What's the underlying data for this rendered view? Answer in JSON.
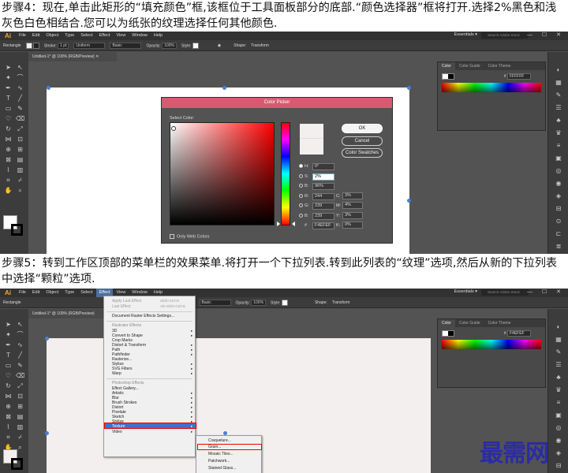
{
  "captions": {
    "step4": "步骤4：现在,单击此矩形的“填充颜色”框,该框位于工具面板部分的底部.“颜色选择器”框将打开.选择2%黑色和浅灰色白色相结合.您可以为纸张的纹理选择任何其他颜色.",
    "step5": "步骤5：转到工作区顶部的菜单栏的效果菜单.将打开一个下拉列表.转到此列表的“纹理”选项,然后从新的下拉列表中选择“颗粒”选项."
  },
  "app": {
    "logo": "Ai",
    "menu": [
      "File",
      "Edit",
      "Object",
      "Type",
      "Select",
      "Effect",
      "View",
      "Window",
      "Help"
    ],
    "workspace": "Essentials ▾",
    "search_placeholder": "Search Adobe Stock",
    "window_controls": "— ☐ ✕"
  },
  "control_bar": {
    "selection": "Rectangle",
    "stroke_label": "Stroke:",
    "stroke_value": "1 pt",
    "profile": "Uniform",
    "brush": "Basic",
    "opacity_label": "Opacity:",
    "opacity_value": "100%",
    "style_label": "Style:",
    "shape_label": "Shape:",
    "transform_label": "Transform"
  },
  "doc_tab": {
    "title": "Untitled-1* @ 100% (RGB/Preview)",
    "close": "✕"
  },
  "color_panel": {
    "tabs": [
      "Color",
      "Color Guide",
      "Color Theme"
    ],
    "hex_label": "#",
    "hex_value": "FFFFFF",
    "hex_value2": "F4EFEF"
  },
  "color_picker": {
    "title": "Color Picker",
    "select_label": "Select Color:",
    "buttons": {
      "ok": "OK",
      "cancel": "Cancel",
      "swatches": "Color Swatches"
    },
    "fields": {
      "h_label": "H:",
      "h_value": "0°",
      "s_label": "S:",
      "s_value": "2%",
      "b_label": "B:",
      "b_value": "96%",
      "r_label": "R:",
      "r_value": "244",
      "g_label": "G:",
      "g_value": "239",
      "bl_label": "B:",
      "bl_value": "239",
      "hex_label": "#",
      "hex_value": "F4EFEF",
      "c_label": "C:",
      "c_value": "3%",
      "m_label": "M:",
      "m_value": "4%",
      "y_label": "Y:",
      "y_value": "3%",
      "k_label": "K:",
      "k_value": "0%"
    },
    "web_only": "Only Web Colors",
    "colors": {
      "current": "#F4EFEF"
    }
  },
  "effect_menu": {
    "top_items": [
      {
        "label": "Apply Last Effect",
        "shortcut": "Shift+Ctrl+E"
      },
      {
        "label": "Last Effect",
        "shortcut": "Alt+Shift+Ctrl+E"
      }
    ],
    "raster_settings": "Document Raster Effects Settings...",
    "illustrator_header": "Illustrator Effects",
    "illustrator_items": [
      "3D",
      "Convert to Shape",
      "Crop Marks",
      "Distort & Transform",
      "Path",
      "Pathfinder",
      "Rasterize...",
      "Stylize",
      "SVG Filters",
      "Warp"
    ],
    "photoshop_header": "Photoshop Effects",
    "photoshop_items": [
      "Effect Gallery...",
      "Artistic",
      "Blur",
      "Brush Strokes",
      "Distort",
      "Pixelate",
      "Sketch",
      "Stylize",
      "Texture",
      "Video"
    ],
    "texture_submenu": [
      "Craquelure...",
      "Grain...",
      "Mosaic Tiles...",
      "Patchwork...",
      "Stained Glass..."
    ]
  },
  "watermark": "最需网"
}
